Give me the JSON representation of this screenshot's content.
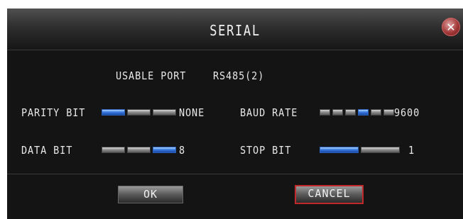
{
  "dialog": {
    "title": "SERIAL",
    "close_icon": "close-icon"
  },
  "usable_port": {
    "label": "USABLE PORT",
    "value": "RS485(2)"
  },
  "parity_bit": {
    "label": "PARITY BIT",
    "value": "NONE",
    "segments": 3,
    "selected_index": 0
  },
  "baud_rate": {
    "label": "BAUD RATE",
    "value": "9600",
    "segments": 6,
    "selected_index": 3
  },
  "data_bit": {
    "label": "DATA BIT",
    "value": "8",
    "segments": 3,
    "selected_index": 2
  },
  "stop_bit": {
    "label": "STOP BIT",
    "value": "1",
    "segments": 2,
    "selected_index": 0
  },
  "buttons": {
    "ok": "OK",
    "cancel": "CANCEL"
  },
  "colors": {
    "background": "#141414",
    "selected_segment": "#3a7de0",
    "focus_border": "#c0282a"
  }
}
